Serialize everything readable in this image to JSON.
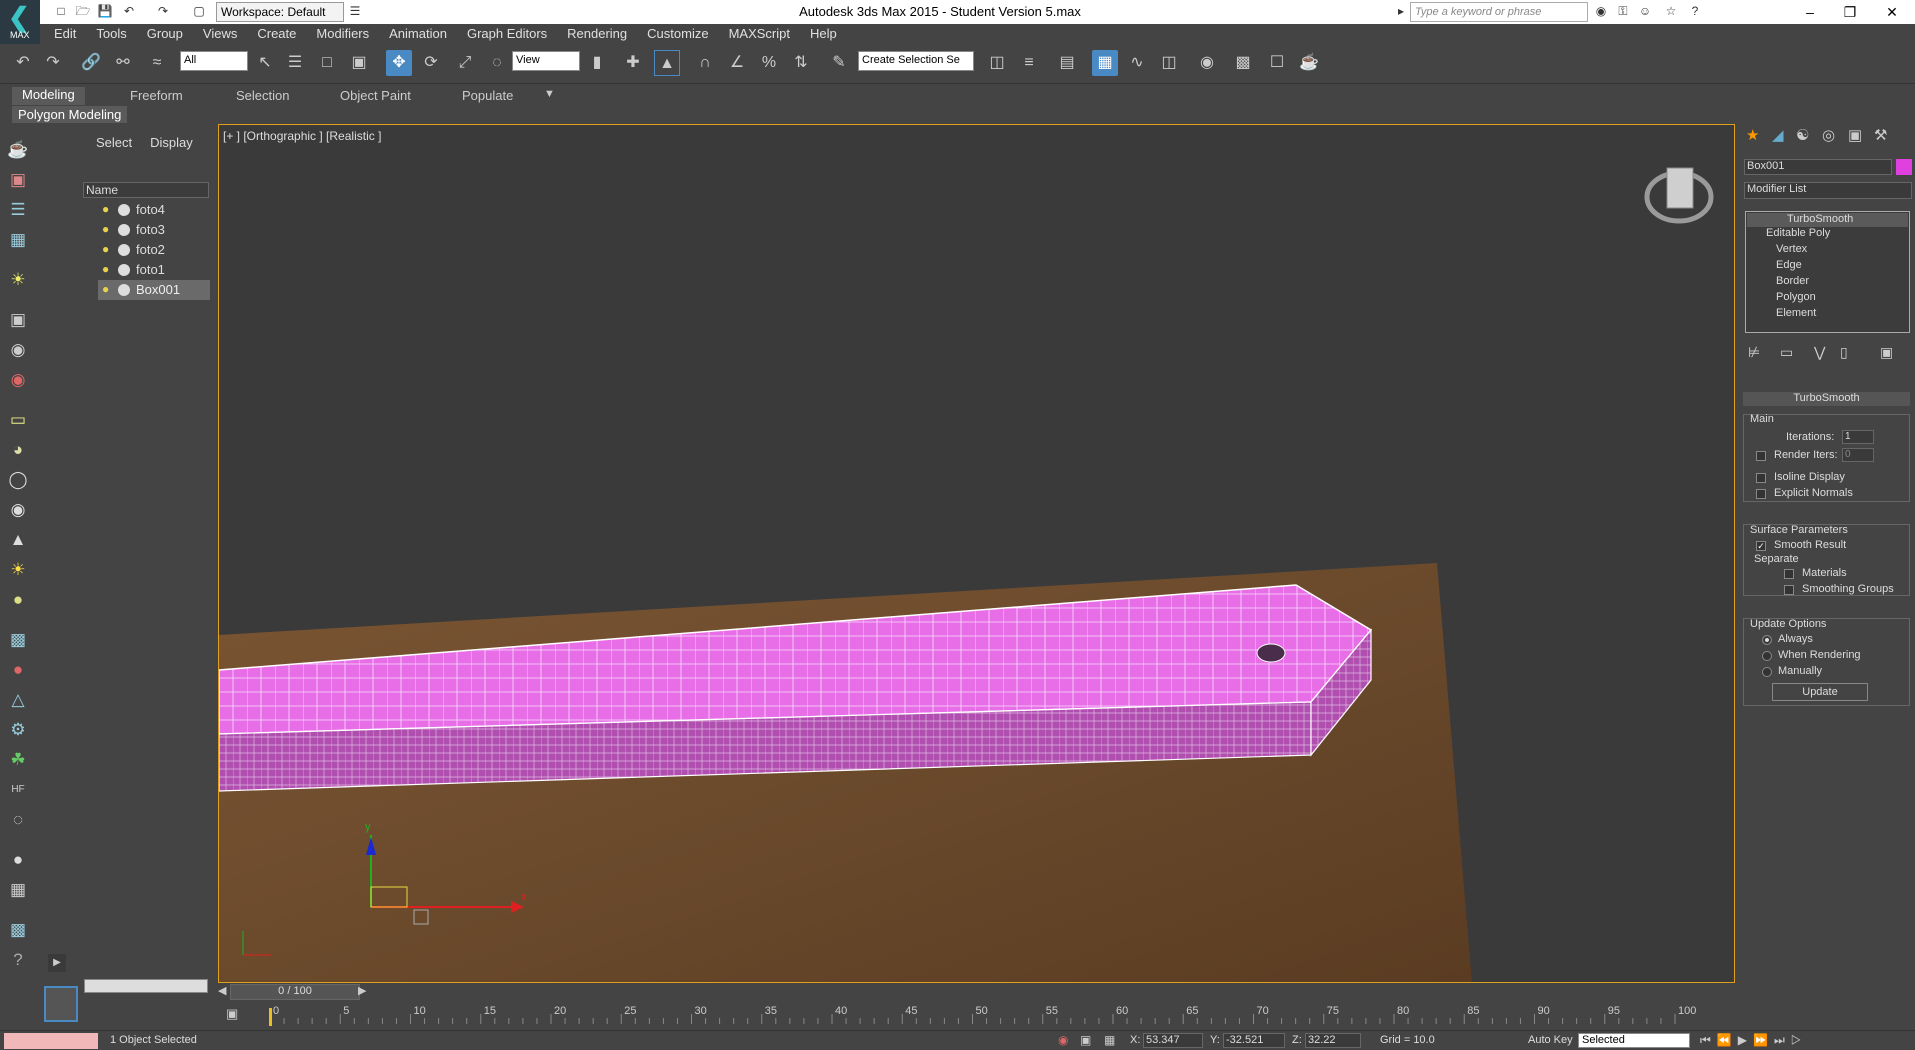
{
  "window": {
    "title": "Autodesk 3ds Max  2015   - Student Version      5.max",
    "workspace": "Workspace: Default",
    "search_placeholder": "Type a keyword or phrase",
    "logo_text": "MAX"
  },
  "menu": [
    "Edit",
    "Tools",
    "Group",
    "Views",
    "Create",
    "Modifiers",
    "Animation",
    "Graph Editors",
    "Rendering",
    "Customize",
    "MAXScript",
    "Help"
  ],
  "toolbar": {
    "selection_filter": "All",
    "ref_coord": "View",
    "named_selection_placeholder": "Create Selection Se"
  },
  "ribbon": {
    "tabs": [
      "Modeling",
      "Freeform",
      "Selection",
      "Object Paint",
      "Populate"
    ],
    "sub_tab": "Polygon Modeling"
  },
  "scene_explorer": {
    "tabs": [
      "Select",
      "Display"
    ],
    "column_header": "Name",
    "objects": [
      "foto4",
      "foto3",
      "foto2",
      "foto1",
      "Box001"
    ]
  },
  "viewport": {
    "label": "[+ ] [Orthographic ] [Realistic ]",
    "frame_counter": "0 / 100",
    "axis_x": "x",
    "axis_y": "y"
  },
  "command_panel": {
    "object_name": "Box001",
    "object_color": "#e040e0",
    "modifier_list": "Modifier List",
    "stack": [
      "TurboSmooth",
      "Editable Poly",
      "Vertex",
      "Edge",
      "Border",
      "Polygon",
      "Element"
    ],
    "rollout_title": "TurboSmooth",
    "main_group": "Main",
    "iterations_label": "Iterations:",
    "iterations_value": "1",
    "render_iters_label": "Render Iters:",
    "render_iters_value": "0",
    "isoline_display": "Isoline Display",
    "explicit_normals": "Explicit Normals",
    "surface_params": "Surface Parameters",
    "smooth_result": "Smooth Result",
    "separate": "Separate",
    "materials": "Materials",
    "smoothing_groups": "Smoothing Groups",
    "update_options": "Update Options",
    "always": "Always",
    "when_rendering": "When Rendering",
    "manually": "Manually",
    "update_button": "Update"
  },
  "timeline": {
    "ticks": [
      "0",
      "5",
      "10",
      "15",
      "20",
      "25",
      "30",
      "35",
      "40",
      "45",
      "50",
      "55",
      "60",
      "65",
      "70",
      "75",
      "80",
      "85",
      "90",
      "95",
      "100"
    ]
  },
  "status": {
    "selection": "1 Object Selected",
    "x_label": "X:",
    "x": "53.347",
    "y_label": "Y:",
    "y": "-32.521",
    "z_label": "Z:",
    "z": "32.22",
    "grid": "Grid = 10.0",
    "auto_key": "Auto Key",
    "key_mode": "Selected"
  },
  "colors": {
    "mesh": "#e86ee8",
    "table": "#6b4a2c",
    "viewport_border": "#e0a01e",
    "accent": "#4a8ac4"
  }
}
